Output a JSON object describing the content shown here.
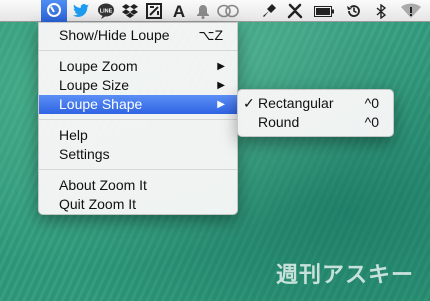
{
  "menubar": {
    "icons": [
      "zoomit-icon",
      "twitter-icon",
      "line-icon",
      "dropbox-icon",
      "zoom-box-icon",
      "a-icon",
      "bell-icon",
      "cc-icon",
      "stamp-icon",
      "tools-icon",
      "battery-icon",
      "time-machine-icon",
      "bluetooth-icon",
      "wifi-icon"
    ]
  },
  "main_menu": {
    "items": [
      {
        "label": "Show/Hide Loupe",
        "shortcut": "⌥Z"
      },
      {
        "label": "Loupe Zoom",
        "arrow": "▶"
      },
      {
        "label": "Loupe Size",
        "arrow": "▶"
      },
      {
        "label": "Loupe Shape",
        "arrow": "▶"
      },
      {
        "label": "Help"
      },
      {
        "label": "Settings"
      },
      {
        "label": "About Zoom It"
      },
      {
        "label": "Quit Zoom It"
      }
    ]
  },
  "sub_menu": {
    "items": [
      {
        "label": "Rectangular",
        "shortcut": "^0",
        "check": "✓"
      },
      {
        "label": "Round",
        "shortcut": "^0"
      }
    ]
  },
  "watermark": "週刊アスキー"
}
